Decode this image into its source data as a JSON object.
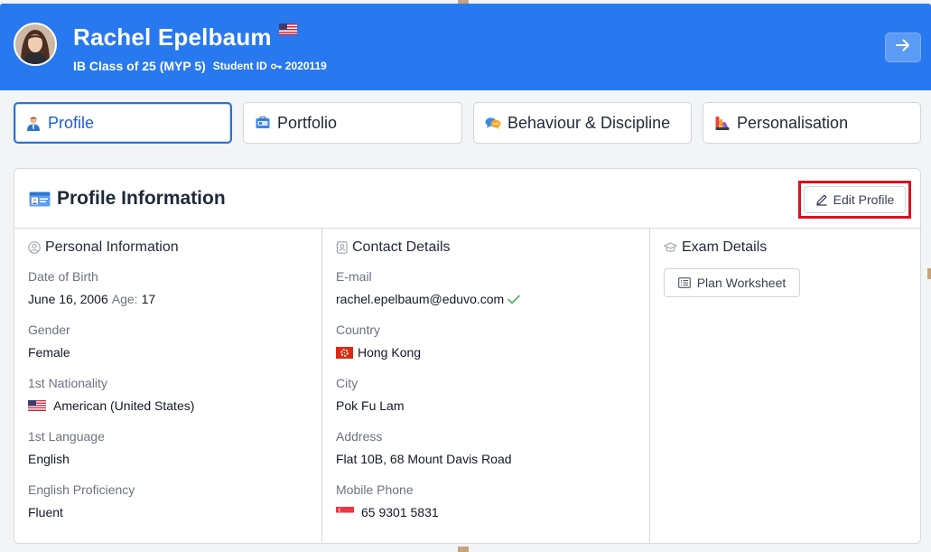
{
  "header": {
    "name": "Rachel Epelbaum",
    "class_label": "IB Class of 25 (MYP 5)",
    "student_id_label": "Student ID",
    "student_id": "2020119",
    "flag_icon": "us-flag-icon",
    "action_icon": "arrow-right-icon",
    "background_color": "#2878f0"
  },
  "tabs": [
    {
      "label": "Profile",
      "icon": "user-icon",
      "active": true
    },
    {
      "label": "Portfolio",
      "icon": "portfolio-icon",
      "active": false
    },
    {
      "label": "Behaviour & Discipline",
      "icon": "chat-bubbles-icon",
      "active": false
    },
    {
      "label": "Personalisation",
      "icon": "palette-icon",
      "active": false
    }
  ],
  "card": {
    "title": "Profile Information",
    "title_icon": "id-card-icon",
    "edit_button_label": "Edit Profile",
    "edit_icon": "pencil-icon",
    "highlight_color": "#e0101b"
  },
  "personal": {
    "title": "Personal Information",
    "fields": {
      "dob_label": "Date of Birth",
      "dob_value": "June 16, 2006",
      "age_label": "Age:",
      "age_value": "17",
      "gender_label": "Gender",
      "gender_value": "Female",
      "nationality_label": "1st Nationality",
      "nationality_value": "American (United States)",
      "language_label": "1st Language",
      "language_value": "English",
      "proficiency_label": "English Proficiency",
      "proficiency_value": "Fluent"
    }
  },
  "contact": {
    "title": "Contact Details",
    "fields": {
      "email_label": "E-mail",
      "email_value": "rachel.epelbaum@eduvo.com",
      "country_label": "Country",
      "country_value": "Hong Kong",
      "city_label": "City",
      "city_value": "Pok Fu Lam",
      "address_label": "Address",
      "address_value": "Flat 10B, 68 Mount Davis Road",
      "phone_label": "Mobile Phone",
      "phone_value": "65 9301 5831"
    }
  },
  "exam": {
    "title": "Exam Details",
    "plan_button_label": "Plan Worksheet"
  }
}
